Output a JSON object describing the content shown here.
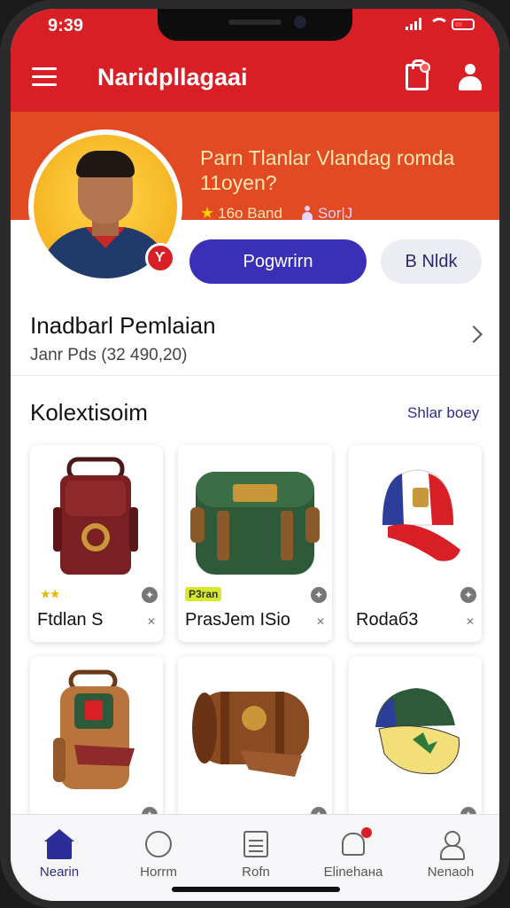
{
  "status_bar": {
    "time": "9:39"
  },
  "header": {
    "title": "Naridpllagaai"
  },
  "profile": {
    "name": "Parn Tlanlar Vlandag romda 11oyen?",
    "rating": "16о Ваnd",
    "followers": "Sor|J",
    "avatar_badge": "Ƴ",
    "primary_button": "Pogwrirn",
    "secondary_button": "B Nldk"
  },
  "section": {
    "title": "Inadbarl Pemlaian",
    "subtitle": "Janr Pds (32 490,20)"
  },
  "collection": {
    "title": "Kolextisoim",
    "link": "Shlar boey",
    "items": [
      {
        "label": "Ftdlan S",
        "tag": "★★",
        "tag_color": "#e8b800"
      },
      {
        "label": "PrasJem ISio",
        "tag": "P3ran",
        "tag_color": "#d7ea2a"
      },
      {
        "label": "Rodaб3",
        "tag": "",
        "tag_color": ""
      },
      {
        "label": "",
        "tag": "",
        "tag_color": ""
      },
      {
        "label": "",
        "tag": "",
        "tag_color": ""
      },
      {
        "label": "",
        "tag": "",
        "tag_color": ""
      }
    ]
  },
  "bottom_nav": [
    {
      "label": "Nearin",
      "active": true
    },
    {
      "label": "Horrm",
      "active": false
    },
    {
      "label": "Rofn",
      "active": false
    },
    {
      "label": "Elinehaнa",
      "active": false
    },
    {
      "label": "Nenaoh",
      "active": false
    }
  ],
  "colors": {
    "brand_red": "#d81f26",
    "accent_orange": "#e24a23",
    "primary_blue": "#3a30b8"
  }
}
